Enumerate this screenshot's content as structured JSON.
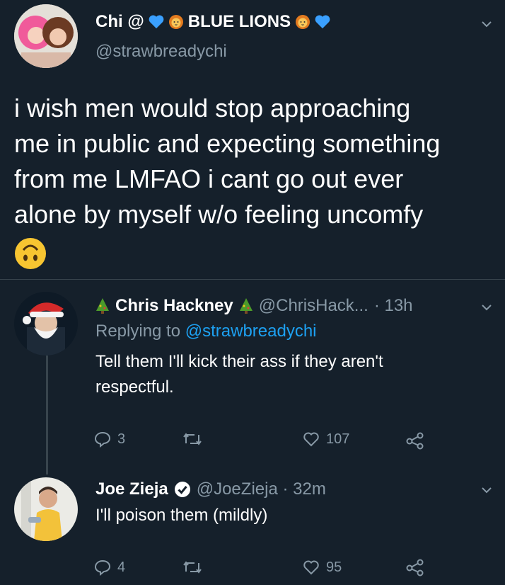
{
  "main_tweet": {
    "display_name": "Chi @",
    "team_label": "BLUE LIONS",
    "handle": "@strawbreadychi",
    "text_lines": [
      "i wish men would stop approaching",
      "me in public and expecting something",
      "from me LMFAO i cant go out ever",
      "alone by myself w/o feeling uncomfy"
    ]
  },
  "reply1": {
    "display_name": "Chris Hackney",
    "handle": "@ChrisHack...",
    "time": "· 13h",
    "replying_prefix": "Replying to",
    "replying_handle": "@strawbreadychi",
    "text_lines": [
      "Tell them I'll kick their ass if they aren't",
      "respectful."
    ],
    "reply_count": "3",
    "like_count": "107"
  },
  "reply2": {
    "display_name": "Joe Zieja",
    "handle_time": "@JoeZieja · 32m",
    "text": "I'll poison them (mildly)",
    "reply_count": "4",
    "like_count": "95"
  },
  "colors": {
    "background": "#15202b",
    "muted": "#8899a6",
    "link": "#1da1f2",
    "divider": "#38444d"
  },
  "icons": [
    "blue-heart-icon",
    "lion-face-icon",
    "upside-down-face-emoji",
    "christmas-tree-icon",
    "verified-badge-icon",
    "reply-icon",
    "retweet-icon",
    "like-icon",
    "share-icon",
    "chevron-down-icon"
  ]
}
